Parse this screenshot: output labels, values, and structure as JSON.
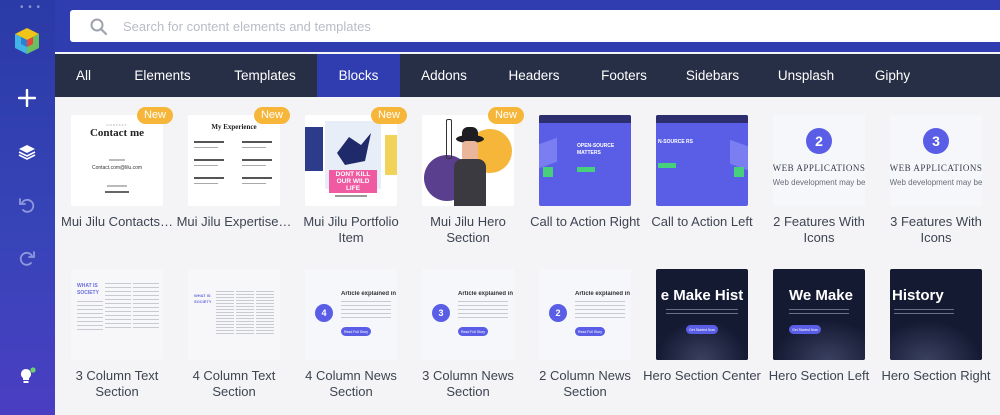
{
  "sidebar": {
    "items": [
      {
        "name": "add-element-icon"
      },
      {
        "name": "layers-icon"
      },
      {
        "name": "undo-icon"
      },
      {
        "name": "redo-icon"
      },
      {
        "name": "hints-bulb-icon"
      }
    ]
  },
  "search": {
    "placeholder": "Search for content elements and templates",
    "value": ""
  },
  "tabs": [
    {
      "label": "All",
      "active": false
    },
    {
      "label": "Elements",
      "active": false
    },
    {
      "label": "Templates",
      "active": false
    },
    {
      "label": "Blocks",
      "active": true
    },
    {
      "label": "Addons",
      "active": false
    },
    {
      "label": "Headers",
      "active": false
    },
    {
      "label": "Footers",
      "active": false
    },
    {
      "label": "Sidebars",
      "active": false
    },
    {
      "label": "Unsplash",
      "active": false
    },
    {
      "label": "Giphy",
      "active": false
    }
  ],
  "badge_label": "New",
  "row1": [
    {
      "title": "Mui Jilu Contacts…",
      "badge": true,
      "thumb": "contacts"
    },
    {
      "title": "Mui Jilu Expertise…",
      "badge": true,
      "thumb": "expertise"
    },
    {
      "title": "Mui Jilu Portfolio Item",
      "badge": true,
      "thumb": "portfolio"
    },
    {
      "title": "Mui Jilu Hero Section",
      "badge": true,
      "thumb": "hero-person"
    },
    {
      "title": "Call to Action Right",
      "badge": false,
      "thumb": "cta-right"
    },
    {
      "title": "Call to Action Left",
      "badge": false,
      "thumb": "cta-left"
    },
    {
      "title": "2 Features With Icons",
      "badge": false,
      "thumb": "feat2"
    },
    {
      "title": "3 Features With Icons",
      "badge": false,
      "thumb": "feat3"
    }
  ],
  "row2": [
    {
      "title": "3 Column Text Section",
      "thumb": "text3"
    },
    {
      "title": "4 Column Text Section",
      "thumb": "text4"
    },
    {
      "title": "4 Column News Section",
      "thumb": "news4"
    },
    {
      "title": "3 Column News Section",
      "thumb": "news3"
    },
    {
      "title": "2 Column News Section",
      "thumb": "news2"
    },
    {
      "title": "Hero Section Center",
      "thumb": "hero-center"
    },
    {
      "title": "Hero Section Left",
      "thumb": "hero-left"
    },
    {
      "title": "Hero Section Right",
      "thumb": "hero-right"
    }
  ],
  "thumb_text": {
    "contacts_heading": "Contact me",
    "contacts_email": "Contact.com@lilu.com",
    "expertise_heading": "My Experience",
    "portfolio_overlay": "DONT KILL OUR WILD LIFE",
    "cta_heading": "OPEN-SOURCE MATTERS",
    "cta_heading_left": "N-SOURCE RS",
    "feat2_number": "2",
    "feat3_number": "3",
    "feat_heading": "WEB APPLICATIONS",
    "feat_sub": "Web development may be",
    "text_heading": "WHAT IS SOCIETY",
    "news_heading": "Article explained in",
    "news_btn": "Read Full Story",
    "news4_number": "4",
    "news3_number": "3",
    "news2_number": "2",
    "hero_center": "e Make Hist",
    "hero_left": "We Make",
    "hero_right": "History",
    "hero_btn": "Get Started Now"
  },
  "colors": {
    "sidebar": "#2a3aa6",
    "topbar": "#2f3db0",
    "tabbar": "#262f45",
    "active_tab": "#2f3db0",
    "badge": "#f5b63a",
    "accent_purple": "#5a5ee6",
    "hero_dark": "#151a33"
  }
}
